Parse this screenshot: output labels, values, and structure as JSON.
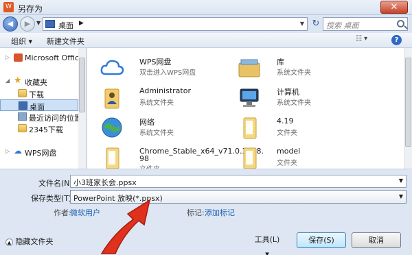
{
  "window": {
    "title": "另存为",
    "app_icon": "wps-app-icon",
    "close_label": "✕"
  },
  "nav": {
    "back_glyph": "◀",
    "forward_glyph": "▶",
    "address_path": "桌面",
    "address_separator": "▶",
    "search_placeholder": "搜索 桌面",
    "refresh_glyph": "↻"
  },
  "toolbar": {
    "organize_label": "组织 ▾",
    "new_folder_label": "新建文件夹",
    "view_glyph": "☷ ▾",
    "help_glyph": "?"
  },
  "sidebar": {
    "items": [
      {
        "label": "Microsoft Office I",
        "icon": "office-icon",
        "expandable": true
      },
      {
        "label": "收藏夹",
        "icon": "star-icon",
        "expandable": true
      },
      {
        "label": "下载",
        "icon": "download-folder-icon"
      },
      {
        "label": "桌面",
        "icon": "desktop-icon",
        "selected": true
      },
      {
        "label": "最近访问的位置",
        "icon": "recent-places-icon"
      },
      {
        "label": "2345下载",
        "icon": "folder-icon"
      },
      {
        "label": "WPS网盘",
        "icon": "cloud-icon",
        "expandable": true
      }
    ]
  },
  "files": [
    {
      "name": "WPS网盘",
      "sub": "双击进入WPS网盘",
      "icon": "cloud-icon"
    },
    {
      "name": "库",
      "sub": "系统文件夹",
      "icon": "library-icon"
    },
    {
      "name": "Administrator",
      "sub": "系统文件夹",
      "icon": "user-folder-icon"
    },
    {
      "name": "计算机",
      "sub": "系统文件夹",
      "icon": "computer-icon"
    },
    {
      "name": "网络",
      "sub": "系统文件夹",
      "icon": "network-icon"
    },
    {
      "name": "4.19",
      "sub": "文件夹",
      "icon": "folder-icon"
    },
    {
      "name": "Chrome_Stable_x64_v71.0.3578.",
      "sub": "98",
      "sub2": "文件夹",
      "icon": "folder-icon"
    },
    {
      "name": "model",
      "sub": "文件夹",
      "icon": "folder-icon"
    }
  ],
  "form": {
    "filename_label": "文件名(N):",
    "filename_value": "小3班家长会.ppsx",
    "filetype_label": "保存类型(T):",
    "filetype_value": "PowerPoint 放映(*.ppsx)",
    "author_label": "作者:",
    "author_value": "微软用户",
    "tags_label": "标记:",
    "tags_value": "添加标记",
    "hide_folders_label": "隐藏文件夹",
    "tools_label": "工具(L) ▾",
    "save_label": "保存(S)",
    "cancel_label": "取消"
  },
  "colors": {
    "accent": "#2f68c4",
    "arrow_red": "#e0301e"
  }
}
